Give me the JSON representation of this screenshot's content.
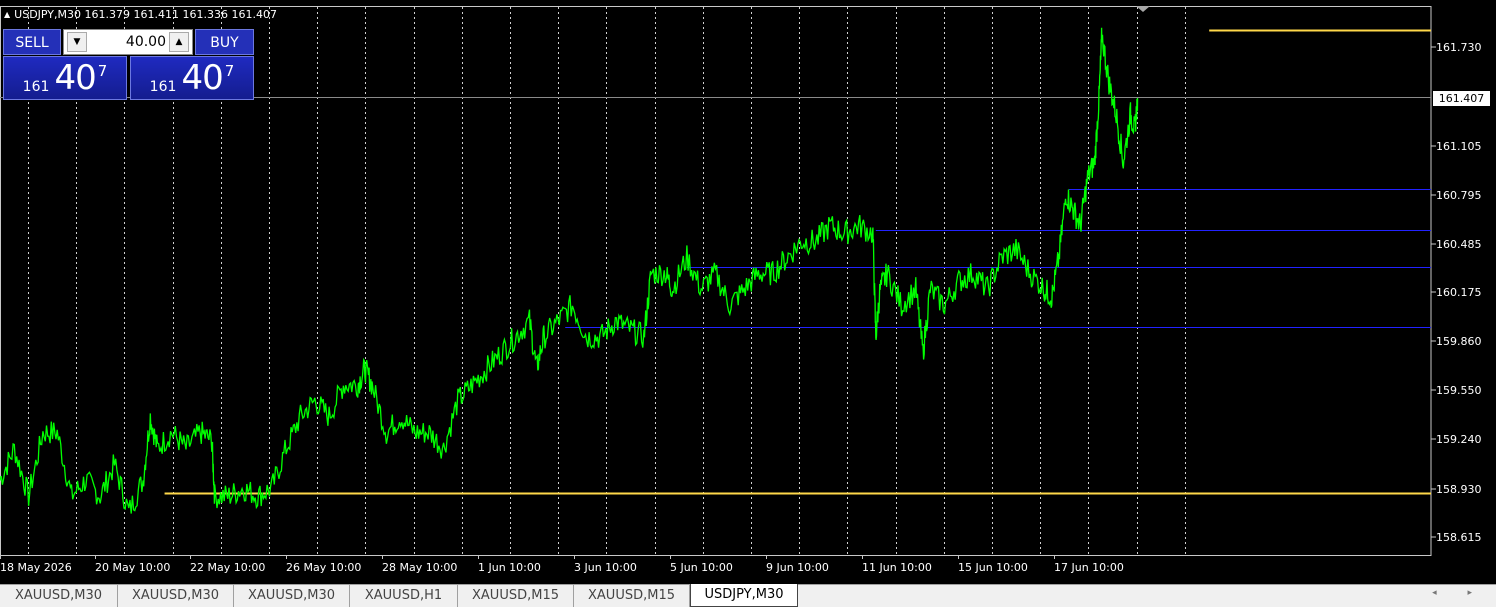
{
  "window": {
    "symbol_line": "USDJPY,M30  161.379 161.411 161.336 161.407"
  },
  "trade_panel": {
    "sell_label": "SELL",
    "buy_label": "BUY",
    "lot_value": "40.00",
    "sell_price": {
      "small": "161",
      "large": "40",
      "sup": "7"
    },
    "buy_price": {
      "small": "161",
      "large": "40",
      "sup": "7"
    }
  },
  "price_badge": "161.407",
  "chart_data": {
    "type": "line",
    "symbol": "USDJPY",
    "timeframe": "M30",
    "y_ticks": [
      "161.730",
      "161.407",
      "161.105",
      "160.795",
      "160.485",
      "160.175",
      "159.860",
      "159.550",
      "159.240",
      "158.930",
      "158.615"
    ],
    "x_ticks": [
      "18 May 2026",
      "20 May 10:00",
      "22 May 10:00",
      "26 May 10:00",
      "28 May 10:00",
      "1 Jun 10:00",
      "3 Jun 10:00",
      "5 Jun 10:00",
      "9 Jun 10:00",
      "11 Jun 10:00",
      "15 Jun 10:00",
      "17 Jun 10:00"
    ],
    "ylim": [
      158.53,
      161.98
    ],
    "current_price": 161.407,
    "grid": "vertical-dotted",
    "line_color": "#00ff00",
    "horizontal_levels": [
      {
        "price": 161.83,
        "color": "#ffd84a",
        "start": 0.845
      },
      {
        "price": 158.92,
        "color": "#ffd84a",
        "start": 0.115
      },
      {
        "price": 160.83,
        "color": "#2222ff",
        "start": 0.747
      },
      {
        "price": 160.57,
        "color": "#2222ff",
        "start": 0.612
      },
      {
        "price": 160.34,
        "color": "#2222ff",
        "start": 0.48
      },
      {
        "price": 159.96,
        "color": "#2222ff",
        "start": 0.395
      }
    ],
    "series": [
      {
        "values": [
          [
            0.0,
            159.0
          ],
          [
            0.01,
            159.2
          ],
          [
            0.02,
            158.9
          ],
          [
            0.03,
            159.3
          ],
          [
            0.04,
            159.3
          ],
          [
            0.05,
            158.9
          ],
          [
            0.06,
            159.0
          ],
          [
            0.07,
            158.9
          ],
          [
            0.08,
            159.1
          ],
          [
            0.09,
            158.8
          ],
          [
            0.1,
            159.0
          ],
          [
            0.105,
            159.4
          ],
          [
            0.11,
            159.2
          ],
          [
            0.12,
            159.3
          ],
          [
            0.13,
            159.2
          ],
          [
            0.14,
            159.3
          ],
          [
            0.148,
            159.25
          ],
          [
            0.15,
            158.9
          ],
          [
            0.16,
            158.9
          ],
          [
            0.17,
            158.95
          ],
          [
            0.18,
            158.9
          ],
          [
            0.19,
            158.95
          ],
          [
            0.2,
            159.2
          ],
          [
            0.21,
            159.4
          ],
          [
            0.22,
            159.5
          ],
          [
            0.23,
            159.4
          ],
          [
            0.24,
            159.6
          ],
          [
            0.25,
            159.6
          ],
          [
            0.255,
            159.7
          ],
          [
            0.26,
            159.6
          ],
          [
            0.27,
            159.3
          ],
          [
            0.28,
            159.4
          ],
          [
            0.29,
            159.3
          ],
          [
            0.3,
            159.3
          ],
          [
            0.31,
            159.2
          ],
          [
            0.32,
            159.5
          ],
          [
            0.33,
            159.6
          ],
          [
            0.34,
            159.7
          ],
          [
            0.35,
            159.8
          ],
          [
            0.36,
            159.9
          ],
          [
            0.37,
            160.0
          ],
          [
            0.375,
            159.7
          ],
          [
            0.38,
            159.9
          ],
          [
            0.39,
            160.0
          ],
          [
            0.4,
            160.1
          ],
          [
            0.41,
            159.9
          ],
          [
            0.42,
            159.9
          ],
          [
            0.43,
            160.0
          ],
          [
            0.44,
            159.95
          ],
          [
            0.45,
            159.9
          ],
          [
            0.455,
            160.3
          ],
          [
            0.465,
            160.3
          ],
          [
            0.47,
            160.2
          ],
          [
            0.48,
            160.4
          ],
          [
            0.49,
            160.2
          ],
          [
            0.5,
            160.3
          ],
          [
            0.51,
            160.1
          ],
          [
            0.52,
            160.2
          ],
          [
            0.53,
            160.3
          ],
          [
            0.54,
            160.3
          ],
          [
            0.55,
            160.4
          ],
          [
            0.56,
            160.5
          ],
          [
            0.57,
            160.5
          ],
          [
            0.58,
            160.6
          ],
          [
            0.59,
            160.55
          ],
          [
            0.6,
            160.6
          ],
          [
            0.61,
            160.55
          ],
          [
            0.612,
            159.9
          ],
          [
            0.615,
            160.2
          ],
          [
            0.62,
            160.3
          ],
          [
            0.63,
            160.1
          ],
          [
            0.64,
            160.2
          ],
          [
            0.645,
            159.8
          ],
          [
            0.65,
            160.2
          ],
          [
            0.66,
            160.1
          ],
          [
            0.67,
            160.25
          ],
          [
            0.68,
            160.3
          ],
          [
            0.69,
            160.2
          ],
          [
            0.7,
            160.4
          ],
          [
            0.71,
            160.45
          ],
          [
            0.72,
            160.3
          ],
          [
            0.73,
            160.2
          ],
          [
            0.735,
            160.15
          ],
          [
            0.74,
            160.4
          ],
          [
            0.745,
            160.8
          ],
          [
            0.75,
            160.7
          ],
          [
            0.755,
            160.6
          ],
          [
            0.76,
            160.9
          ],
          [
            0.765,
            161.0
          ],
          [
            0.768,
            161.4
          ],
          [
            0.77,
            161.8
          ],
          [
            0.775,
            161.5
          ],
          [
            0.78,
            161.3
          ],
          [
            0.785,
            161.0
          ],
          [
            0.79,
            161.3
          ],
          [
            0.793,
            161.2
          ],
          [
            0.795,
            161.4
          ]
        ]
      }
    ]
  },
  "tabs": [
    {
      "label": "XAUUSD,M30",
      "active": false
    },
    {
      "label": "XAUUSD,M30",
      "active": false
    },
    {
      "label": "XAUUSD,M30",
      "active": false
    },
    {
      "label": "XAUUSD,H1",
      "active": false
    },
    {
      "label": "XAUUSD,M15",
      "active": false
    },
    {
      "label": "XAUUSD,M15",
      "active": false
    },
    {
      "label": "USDJPY,M30",
      "active": true
    }
  ],
  "tab_scroll": "◂ ▸"
}
